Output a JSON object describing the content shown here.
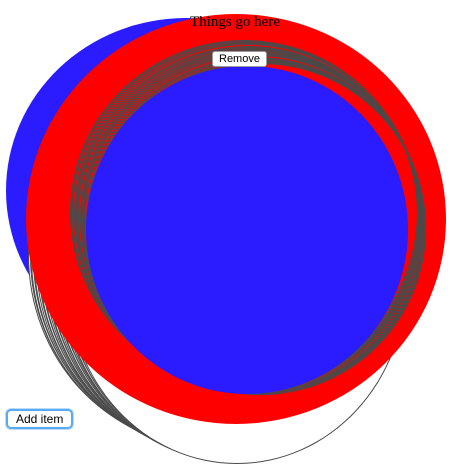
{
  "item": {
    "title": "Things go here",
    "remove_label": "Remove"
  },
  "add_item_label": "Add item",
  "colors": {
    "disc_fill": "#2b1bff",
    "ring_fill": "#ff0000",
    "stack_fill": "#ffffff",
    "stack_outline": "#4a4a4a",
    "focus_ring": "#5aa9f4"
  }
}
